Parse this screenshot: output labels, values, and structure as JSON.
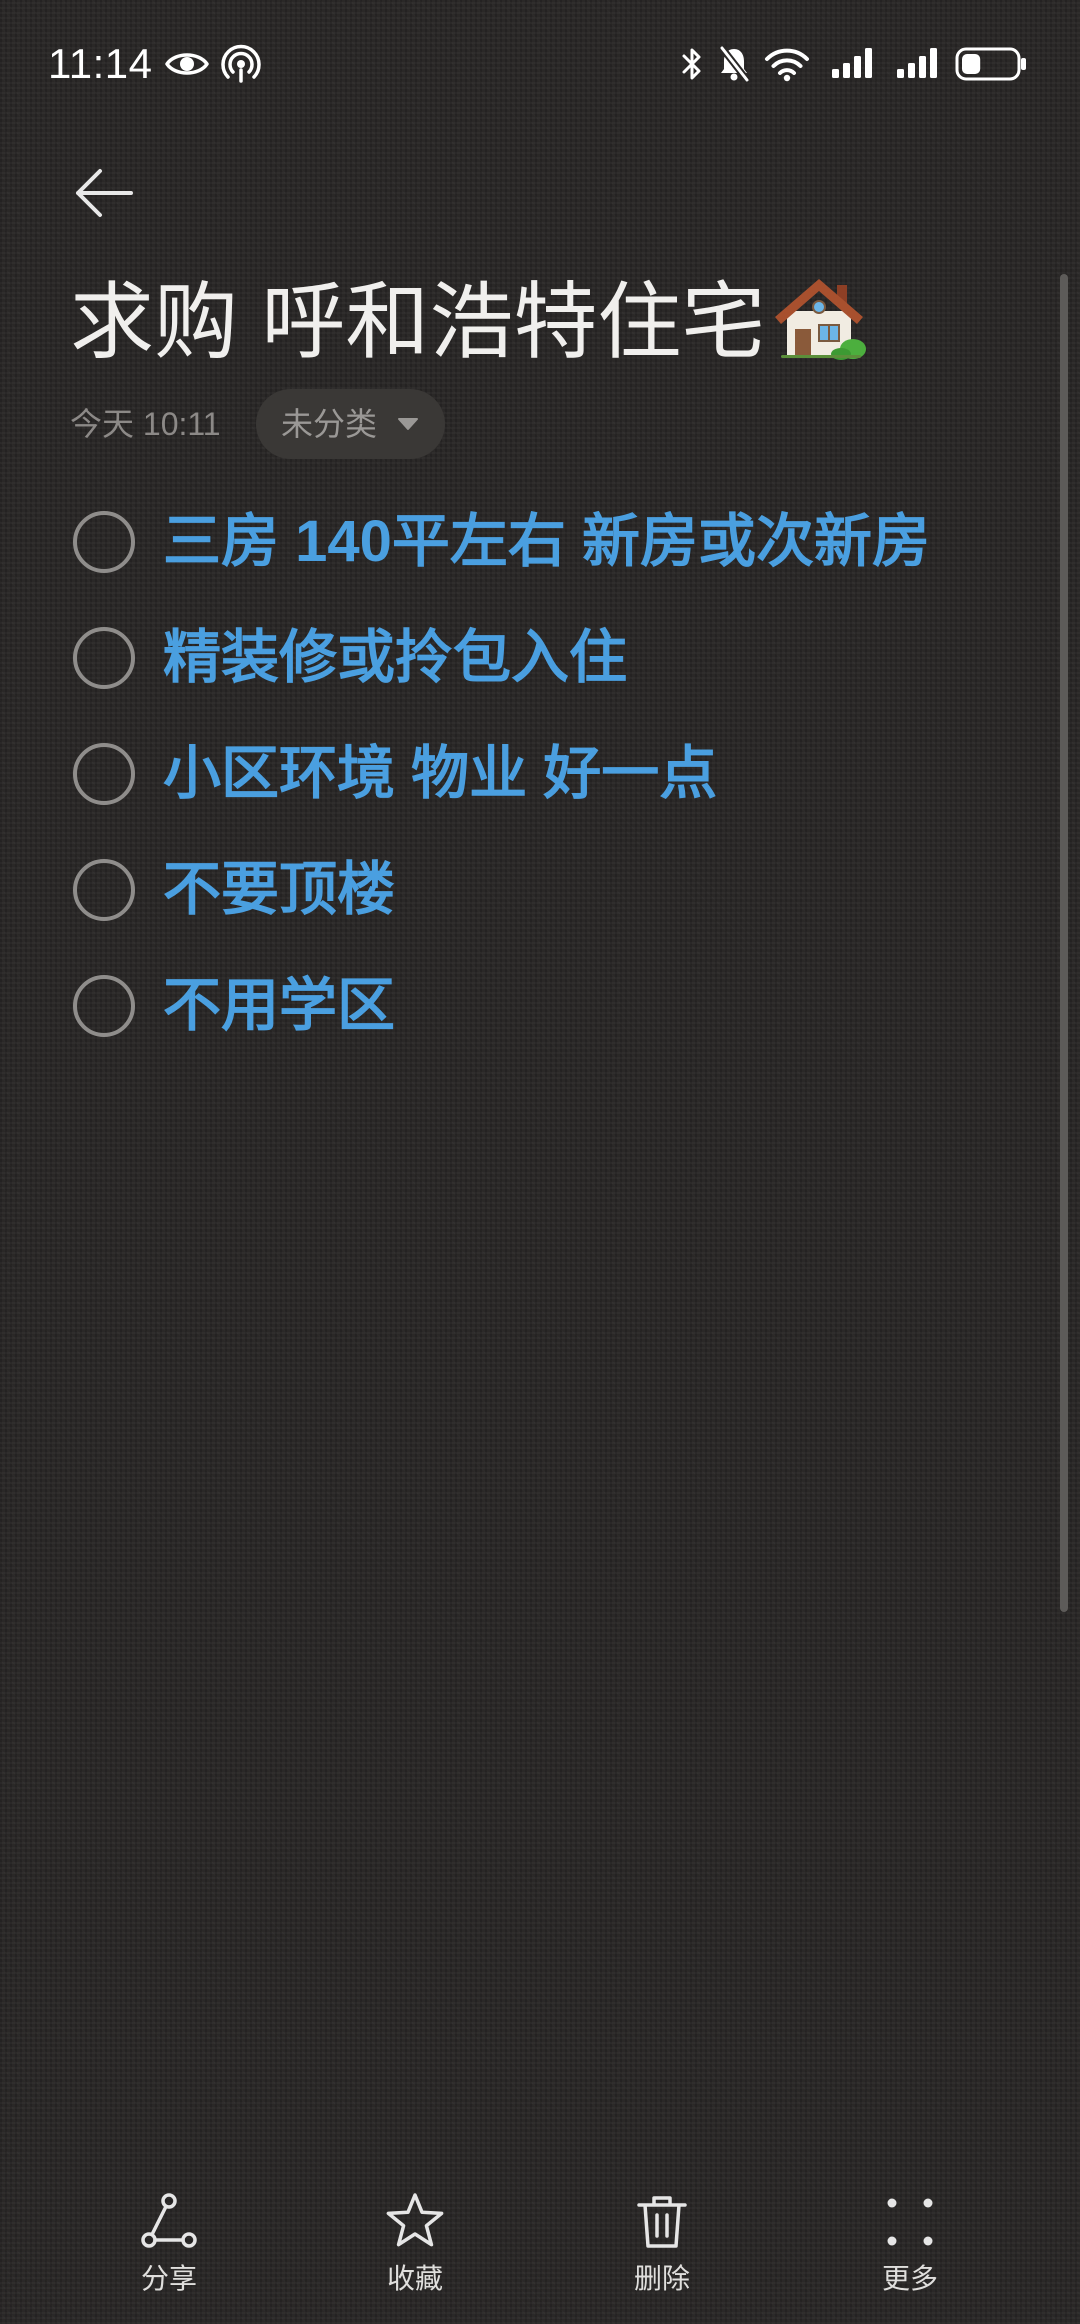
{
  "status_bar": {
    "time": "11:14",
    "left_icons": [
      "eye-icon",
      "hotspot-icon"
    ],
    "right_icons": [
      "bluetooth-icon",
      "bell-off-icon",
      "wifi-icon",
      "signal-icon",
      "signal-icon",
      "battery-icon"
    ],
    "signal_1_level": 4,
    "signal_2_level": 4,
    "signal_max": 4,
    "battery_level": 0.35
  },
  "header": {
    "back_icon": "arrow-left-icon"
  },
  "note": {
    "title": "求购 呼和浩特住宅",
    "title_emoji_icon": "house-emoji-icon",
    "date": "今天 10:11",
    "category": "未分类",
    "category_icon": "caret-down-icon"
  },
  "checklist": [
    {
      "text": "三房 140平左右 新房或次新房",
      "checked": false
    },
    {
      "text": "精装修或拎包入住",
      "checked": false
    },
    {
      "text": "小区环境 物业 好一点",
      "checked": false
    },
    {
      "text": "不要顶楼",
      "checked": false
    },
    {
      "text": "不用学区",
      "checked": false
    }
  ],
  "toolbar": [
    {
      "icon": "share-icon",
      "label": "分享"
    },
    {
      "icon": "star-icon",
      "label": "收藏"
    },
    {
      "icon": "trash-icon",
      "label": "删除"
    },
    {
      "icon": "more-icon",
      "label": "更多"
    }
  ],
  "colors": {
    "background": "#2a2827",
    "accent": "#4a9fe0",
    "text": "#f0efed",
    "muted": "#8c8987",
    "chip_bg": "#3a3836",
    "chip_text": "#9a9896",
    "circle": "#8f8d8b",
    "scrollbar": "#5d5b59",
    "icon": "#e6e6e6"
  }
}
